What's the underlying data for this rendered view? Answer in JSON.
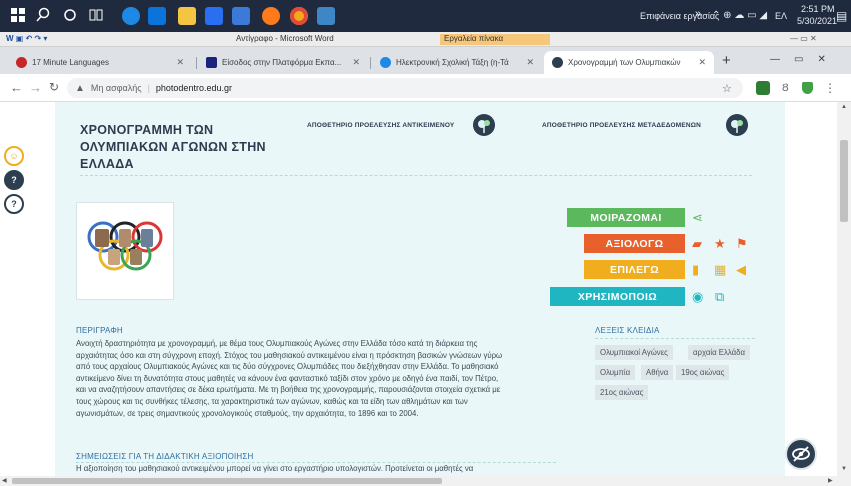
{
  "taskbar": {
    "search_label": "Επιφάνεια εργασίας",
    "chevron": "»",
    "language": "ΕΛ",
    "time": "2:51 PM",
    "date": "5/30/2021"
  },
  "word": {
    "title": "Αντίγραφο - Microsoft Word",
    "context_tab": "Εργαλεία πίνακα"
  },
  "browser": {
    "tabs": [
      {
        "label": "17 Minute Languages",
        "fav_color": "#c62828"
      },
      {
        "label": "Είσοδος στην Πλατφόρμα Εκπα...",
        "fav_color": "#1a237e"
      },
      {
        "label": "Ηλεκτρονική Σχολική Τάξη (η-Τά",
        "fav_color": "#1e88e5"
      },
      {
        "label": "Χρονογραμμή των Ολυμπιακών",
        "fav_color": "#2c3e50"
      }
    ],
    "new_tab": "+",
    "security": "Μη ασφαλής",
    "url": "photodentro.edu.gr"
  },
  "page": {
    "title_lines": [
      "ΧΡΟΝΟΓΡΑΜΜΗ ΤΩΝ",
      "ΟΛΥΜΠΙΑΚΩΝ ΑΓΩΝΩΝ ΣΤΗΝ",
      "ΕΛΛΑΔΑ"
    ],
    "repo_objects": "ΑΠΟΘΕΤΗΡΙΟ ΠΡΟΕΛΕΥΣΗΣ ΑΝΤΙΚΕΙΜΕΝΟΥ",
    "repo_metadata": "ΑΠΟΘΕΤΗΡΙΟ ΠΡΟΕΛΕΥΣΗΣ ΜΕΤΑΔΕΔΟΜΕΝΩΝ",
    "actions": {
      "share": "ΜΟΙΡΑΖΟΜΑΙ",
      "rate": "ΑΞΙΟΛΟΓΩ",
      "select": "ΕΠΙΛΕΓΩ",
      "use": "ΧΡΗΣΙΜΟΠΟΙΩ"
    },
    "description": {
      "title": "ΠΕΡΙΓΡΑΦΗ",
      "lines": [
        "Ανοιχτή δραστηριότητα με χρονογραμμή, με θέμα τους Ολυμπιακούς Αγώνες στην Ελλάδα τόσο κατά τη διάρκεια της",
        "αρχαιότητας όσο και στη σύγχρονη εποχή. Στόχος του μαθησιακού αντικειμένου είναι η πρόσκτηση βασικών γνώσεων γύρω",
        "από τους αρχαίους Ολυμπιακούς Αγώνες και τις δύο σύγχρονες Ολυμπιάδες που διεξήχθησαν στην Ελλάδα. Το μαθησιακό",
        "αντικείμενο δίνει τη δυνατότητα στους μαθητές να κάνουν ένα φανταστικό ταξίδι στον χρόνο με οδηγό ένα παιδί, τον Πέτρο,",
        "και να αναζητήσουν απαντήσεις σε δέκα ερωτήματα. Με τη βοήθεια της χρονογραμμής, παρουσιάζονται στοιχεία σχετικά με",
        "τους χώρους και τις συνθήκες τέλεσης, τα χαρακτηριστικά των αγώνων, καθώς και τα είδη των αθλημάτων και των",
        "αγωνισμάτων, σε τρεις σημαντικούς χρονολογικούς σταθμούς, την αρχαιότητα, το 1896 και το 2004."
      ]
    },
    "keywords": {
      "title": "ΛΕΞΕΙΣ ΚΛΕΙΔΙΑ",
      "items": [
        "Ολυμπιακοί Αγώνες",
        "αρχαία Ελλάδα",
        "Ολυμπία",
        "Αθήνα",
        "19ος αιώνας",
        "21ος αιώνας"
      ]
    },
    "notes": {
      "title": "ΣΗΜΕΙΩΣΕΙΣ ΓΙΑ ΤΗ ΔΙΔΑΚΤΙΚΗ ΑΞΙΟΠΟΙΗΣΗ",
      "text": "Η αξιοποίηση του μαθησιακού αντικειμένου μπορεί να γίνει στο εργαστήριο υπολογιστών. Προτείνεται οι μαθητές να"
    },
    "side_buttons": [
      "☺",
      "?",
      "?"
    ]
  },
  "colors": {
    "share": "#5cb85c",
    "rate": "#e8612c",
    "select": "#f0ad1e",
    "use": "#1fb5c1",
    "card_bg": "#e9f7f8"
  }
}
